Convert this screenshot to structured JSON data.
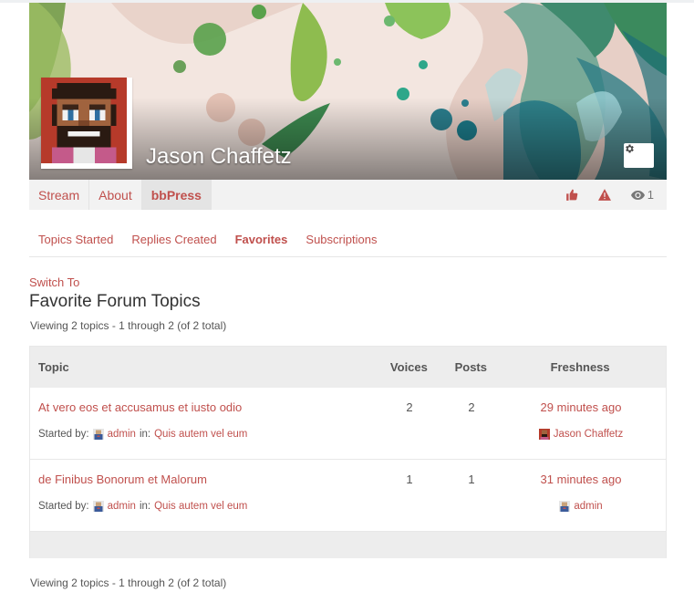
{
  "profile": {
    "name": "Jason Chaffetz",
    "settings_icon": "gear-icon"
  },
  "profile_nav": {
    "items": [
      {
        "label": "Stream"
      },
      {
        "label": "About"
      },
      {
        "label": "bbPress"
      }
    ],
    "icons": {
      "like": "thumbs-up-icon",
      "report": "warning-icon",
      "views": "eye-icon"
    },
    "views_count": "1"
  },
  "subtabs": [
    {
      "label": "Topics Started"
    },
    {
      "label": "Replies Created"
    },
    {
      "label": "Favorites"
    },
    {
      "label": "Subscriptions"
    }
  ],
  "switch_to": "Switch To",
  "section_title": "Favorite Forum Topics",
  "pagination_text": "Viewing 2 topics - 1 through 2 (of 2 total)",
  "table": {
    "headers": {
      "topic": "Topic",
      "voices": "Voices",
      "posts": "Posts",
      "freshness": "Freshness"
    },
    "rows": [
      {
        "title": "At vero eos et accusamus et iusto odio",
        "voices": "2",
        "posts": "2",
        "freshness": "29 minutes ago",
        "started_by_label": "Started by:",
        "author": "admin",
        "in_label": "in:",
        "forum": "Quis autem vel eum",
        "last_author": "Jason Chaffetz"
      },
      {
        "title": "de Finibus Bonorum et Malorum",
        "voices": "1",
        "posts": "1",
        "freshness": "31 minutes ago",
        "started_by_label": "Started by:",
        "author": "admin",
        "in_label": "in:",
        "forum": "Quis autem vel eum",
        "last_author": "admin"
      }
    ]
  },
  "colors": {
    "accent": "#c0504d",
    "header_bg": "#ededed"
  }
}
